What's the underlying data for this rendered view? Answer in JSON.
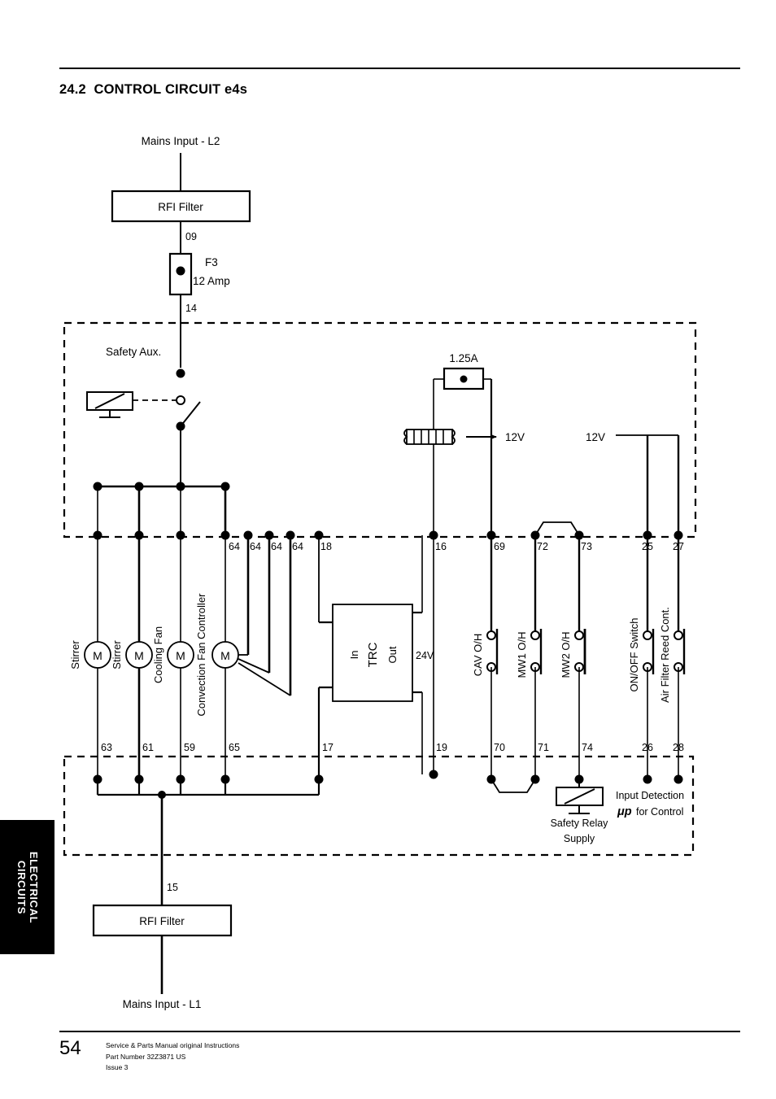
{
  "document": {
    "section_number": "24.2",
    "section_title": "CONTROL CIRCUIT e4s",
    "heading": "24.2  CONTROL CIRCUIT e4s",
    "side_tab_label": "ELECTRICAL\nCIRCUITS",
    "page_number": "54",
    "footer_line_1": "Service & Parts Manual original Instructions",
    "footer_line_2": "Part Number 32Z3871 US",
    "footer_line_3": "Issue 3"
  },
  "diagram": {
    "type": "schematic",
    "title": "CONTROL CIRCUIT e4s",
    "labels": {
      "mains_input_l2": "Mains Input - L2",
      "mains_input_l1": "Mains Input - L1",
      "rfi_filter_top": "RFI Filter",
      "rfi_filter_bottom": "RFI Filter",
      "fuse_f3_name": "F3",
      "fuse_f3_rating": "12 Amp",
      "fuse_125a": "1.25A",
      "safety_aux": "Safety Aux.",
      "transformer_out_12v": "12V",
      "supply_12v": "12V",
      "trc_in": "In",
      "trc_name": "TRC",
      "trc_out": "Out",
      "trc_24v": "24V",
      "safety_relay_supply_line1": "Safety Relay",
      "safety_relay_supply_line2": "Supply",
      "input_detection_line1": "Input Detection",
      "input_detection_symbol": "μp",
      "input_detection_line2_rest": " for Control"
    },
    "wire_numbers": {
      "rfi_top_out": "09",
      "fuse_f3_out": "14",
      "rfi_bottom_in": "15",
      "top_rail": [
        "64",
        "64",
        "64",
        "64",
        "18",
        "16",
        "69",
        "72",
        "73",
        "25",
        "27"
      ],
      "bottom_rail": [
        "63",
        "61",
        "59",
        "65",
        "17",
        "19",
        "70",
        "71",
        "74",
        "26",
        "28"
      ]
    },
    "devices": [
      {
        "name": "Stirrer",
        "symbol": "M",
        "top_terminal": "64",
        "bottom_terminal": "63"
      },
      {
        "name": "Stirrer",
        "symbol": "M",
        "top_terminal": "64",
        "bottom_terminal": "61"
      },
      {
        "name": "Cooling Fan",
        "symbol": "M",
        "top_terminal": "64",
        "bottom_terminal": "59"
      },
      {
        "name": "Convection Fan Controller",
        "symbol": "M",
        "top_terminal": "64",
        "bottom_terminal": "65"
      },
      {
        "name": "TRC",
        "symbol": "box",
        "top_terminal": "18",
        "bottom_terminal": "17"
      },
      {
        "name": "CAV O/H",
        "symbol": "switch",
        "top_terminal": "69",
        "bottom_terminal": "70"
      },
      {
        "name": "MW1 O/H",
        "symbol": "switch",
        "top_terminal": "72",
        "bottom_terminal": "71"
      },
      {
        "name": "MW2 O/H",
        "symbol": "switch",
        "top_terminal": "73",
        "bottom_terminal": "74"
      },
      {
        "name": "ON/OFF Switch",
        "symbol": "switch",
        "top_terminal": "25",
        "bottom_terminal": "26"
      },
      {
        "name": "Air Filter Reed Cont.",
        "symbol": "switch",
        "top_terminal": "27",
        "bottom_terminal": "28"
      }
    ],
    "device_labels": {
      "stirrer_1": "Stirrer",
      "stirrer_2": "Stirrer",
      "cooling_fan": "Cooling Fan",
      "convection_fan_controller": "Convection Fan Controller",
      "cav_oh": "CAV O/H",
      "mw1_oh": "MW1 O/H",
      "mw2_oh": "MW2 O/H",
      "on_off_switch": "ON/OFF Switch",
      "air_filter_reed_cont": "Air Filter Reed Cont.",
      "motor_symbol": "M"
    },
    "colors": {
      "line": "#000000",
      "background": "#ffffff",
      "tab_background": "#000000",
      "tab_text": "#ffffff"
    }
  }
}
